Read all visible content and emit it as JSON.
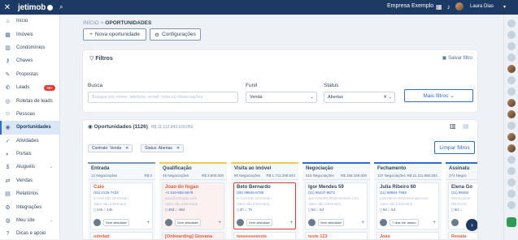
{
  "topbar": {
    "close_icon": "close-icon",
    "logo_text": "jetimob",
    "company": "Empresa Exemplo",
    "user": "Laura Dias"
  },
  "sidebar": {
    "items": [
      {
        "label": "Início",
        "icon": "house-icon",
        "glyph": "⌂"
      },
      {
        "label": "Imóveis",
        "icon": "building-icon",
        "glyph": "▦"
      },
      {
        "label": "Condomínios",
        "icon": "condo-icon",
        "glyph": "▥"
      },
      {
        "label": "Chaves",
        "icon": "key-icon",
        "glyph": "⚷"
      },
      {
        "label": "Propostas",
        "icon": "handshake-icon",
        "glyph": "✎"
      },
      {
        "label": "Leads",
        "icon": "megaphone-icon",
        "glyph": "✆",
        "badge": "99+"
      },
      {
        "label": "Roletas de leads",
        "icon": "roulette-icon",
        "glyph": "◎"
      },
      {
        "label": "Pessoas",
        "icon": "people-icon",
        "glyph": "☺"
      },
      {
        "label": "Oportunidades",
        "icon": "target-icon",
        "glyph": "◉",
        "active": true
      },
      {
        "label": "Atividades",
        "icon": "check-icon",
        "glyph": "✓"
      },
      {
        "label": "Portais",
        "icon": "portal-icon",
        "glyph": "◐"
      },
      {
        "label": "Aluguéis",
        "icon": "rent-icon",
        "glyph": "$",
        "chevron": true
      },
      {
        "label": "Vendas",
        "icon": "sales-icon",
        "glyph": "⇄"
      },
      {
        "label": "Relatórios",
        "icon": "report-icon",
        "glyph": "▤"
      },
      {
        "label": "Integrações",
        "icon": "integration-icon",
        "glyph": "⚙"
      },
      {
        "label": "Meu site",
        "icon": "globe-icon",
        "glyph": "◍",
        "chevron": true
      }
    ],
    "bottom": {
      "label": "Dicas e apoio",
      "glyph": "?"
    }
  },
  "breadcrumb": {
    "root": "INÍCIO",
    "sep": " > ",
    "current": "OPORTUNIDADES"
  },
  "actions": {
    "new_label": "Nova oportunidade",
    "config_label": "Configurações"
  },
  "filters": {
    "title": "Filtros",
    "save_label": "Salvar filtro",
    "search": {
      "label": "Busca",
      "placeholder": "Busque por nome, telefone, email, nota ou observações"
    },
    "funnel": {
      "label": "Funil",
      "value": "Venda"
    },
    "status": {
      "label": "Status",
      "value": "Abertas"
    },
    "more_label": "Mais filtros"
  },
  "opportunities": {
    "title": "Oportunidades (1126)",
    "summary": "R$ 11.112.943.109.056",
    "chips": [
      "Contrato: Venda",
      "Status: Abertas"
    ],
    "clear_label": "Limpar filtros"
  },
  "columns": [
    {
      "title": "Entrada",
      "count": "12 Negociações",
      "value": "R$ 0",
      "color": "#7c98b6",
      "card": {
        "name": "Caio",
        "phone": "(51) 2125-7433",
        "line1": "E-mail não informado",
        "line2": "Valor não informado",
        "icons": "▯ 14k  ⌂ 14k",
        "tag": "Sem atividade!",
        "pink": false
      },
      "card2": {
        "name": "odedad",
        "line": "Telefone não informado",
        "pink": false
      }
    },
    {
      "title": "Qualificação",
      "count": "46 Negociações",
      "value": "R$ 3.800.000",
      "color": "#f2c94c",
      "card": {
        "name": "Joao do fogao",
        "phone": "+1 310-555-5678",
        "line1": "joao@dofogao.com",
        "line2": "Valor não informado",
        "icons": "▯ 48d  ⌂ 48d",
        "tag": "Sem atividade!",
        "pink": true
      },
      "card2": {
        "name": "[Onboarding] Giovana",
        "line": "(47) 3339-5645",
        "pink": true
      }
    },
    {
      "title": "Visita ao imóvel",
      "count": "90 Negociações",
      "value": "R$ 1.711.295.944",
      "color": "#f2c94c",
      "card": {
        "name": "Beto Bernardo",
        "phone": "(55) 99845-6789",
        "line1": "E-mail não informado",
        "line2": "Valor não informado",
        "icons": "▯ 2h  ⌂ 7h",
        "tag": "Sem atividade!",
        "pink": false,
        "selected": true
      },
      "card2": {
        "name": "teeeeeeeeeste",
        "line": "(47) 99914-6818",
        "pink": false
      }
    },
    {
      "title": "Negociação",
      "count": "515 Negociações",
      "value": "R$ 168.169.000",
      "color": "#2d6bcf",
      "card": {
        "name": "Igor Mendes 59",
        "phone": "(11) 95237-8672",
        "line1": "igor.mendes.59@exemplo.com",
        "line2": "Valor não informado",
        "icons": "▯ 5d  ⌂ 5d",
        "tag": "Sem atividade!",
        "pink": false
      },
      "card2": {
        "name": "teste 123",
        "line": "(47) 4322-3568",
        "pink": false
      }
    },
    {
      "title": "Fechamento",
      "count": "137 Negociações",
      "value": "R$ 11.111.658.294.",
      "color": "#2d6bcf",
      "card": {
        "name": "Julia Ribeiro 60",
        "phone": "(11) 98684-7995",
        "line1": "julia.ribeiro.60@exemplo.com",
        "line2": "Valor não informado",
        "icons": "▯ 5d  ⌂ 5d",
        "tag": "7 dias em atraso",
        "pink": false
      },
      "card2": {
        "name": "Joao",
        "line": "(47) 99716-5433",
        "pink": false
      }
    },
    {
      "title": "Assinatu",
      "count": "274 Negoc",
      "value": "",
      "color": "#2d6bcf",
      "card": {
        "name": "Elena Go",
        "phone": "(11) 98464",
        "line1": "elena.gome",
        "line2": "R$ 60.00",
        "icons": "▯ 6d  ⌂",
        "tag": "",
        "pink": false
      },
      "card2": {
        "name": "Renata",
        "line": "(47) 3304",
        "pink": false
      }
    }
  ],
  "colors": {
    "navy": "#1c3a63",
    "accent": "#2d6bcf",
    "danger": "#e53935"
  }
}
